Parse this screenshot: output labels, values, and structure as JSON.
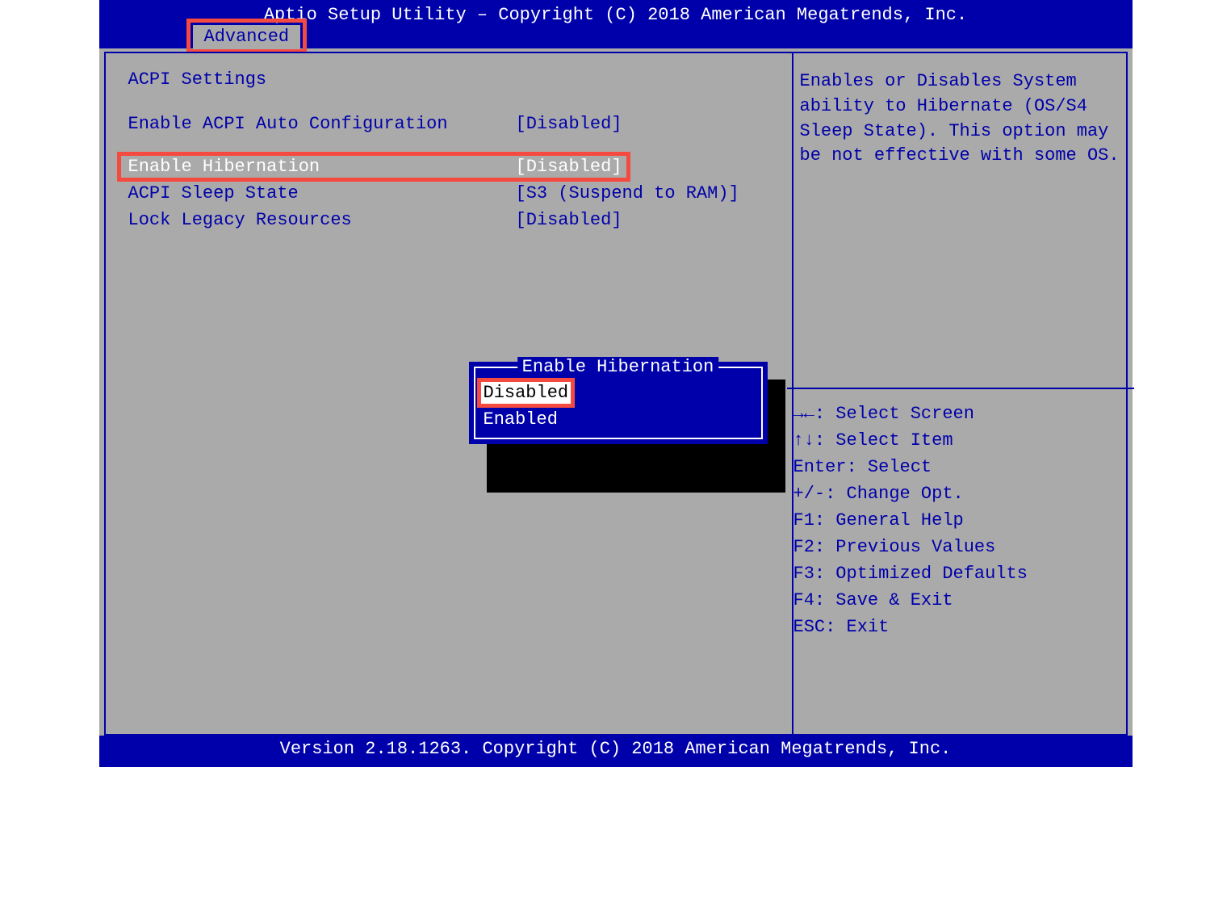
{
  "header": {
    "title": "Aptio Setup Utility – Copyright (C) 2018 American Megatrends, Inc.",
    "tab": "Advanced"
  },
  "section_title": "ACPI Settings",
  "settings": [
    {
      "label": "Enable ACPI Auto Configuration",
      "value": "[Disabled]"
    },
    {
      "label": "Enable Hibernation",
      "value": "[Disabled]"
    },
    {
      "label": "ACPI Sleep State",
      "value": "[S3 (Suspend to RAM)]"
    },
    {
      "label": "Lock Legacy Resources",
      "value": "[Disabled]"
    }
  ],
  "popup": {
    "title": "Enable Hibernation",
    "options": [
      "Disabled",
      "Enabled"
    ]
  },
  "help_text": "Enables or Disables System ability to Hibernate (OS/S4 Sleep State). This option may be not effective with some OS.",
  "keyhelp": [
    "→←: Select Screen",
    "↑↓: Select Item",
    "Enter: Select",
    "+/-: Change Opt.",
    "F1: General Help",
    "F2: Previous Values",
    "F3: Optimized Defaults",
    "F4: Save & Exit",
    "ESC: Exit"
  ],
  "footer": "Version 2.18.1263. Copyright (C) 2018 American Megatrends, Inc."
}
